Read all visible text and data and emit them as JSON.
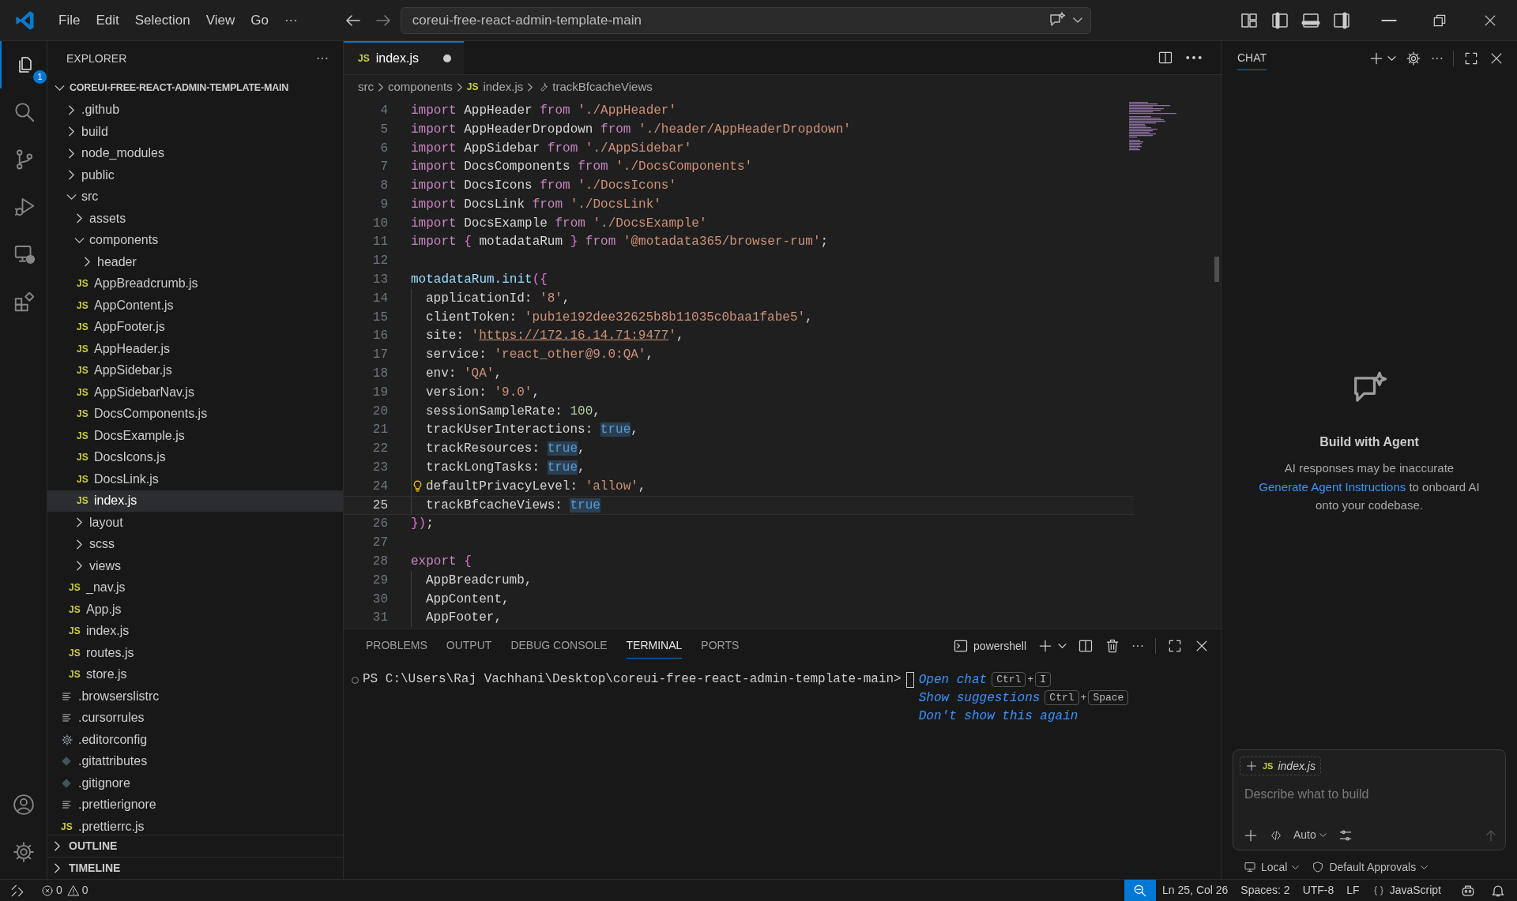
{
  "title_bar": {
    "menu": [
      "File",
      "Edit",
      "Selection",
      "View",
      "Go",
      "···"
    ],
    "command_center": "coreui-free-react-admin-template-main"
  },
  "activity_bar": {
    "top": [
      {
        "kind": "explorer",
        "selected": true,
        "badge": "1"
      },
      {
        "kind": "search",
        "selected": false
      },
      {
        "kind": "source_control",
        "selected": false
      },
      {
        "kind": "run_debug",
        "selected": false
      },
      {
        "kind": "remote",
        "selected": false
      },
      {
        "kind": "extensions",
        "selected": false
      }
    ],
    "bottom": [
      {
        "kind": "account"
      },
      {
        "kind": "settings"
      }
    ]
  },
  "explorer": {
    "title": "EXPLORER",
    "more": "···",
    "tree": {
      "label": "COREUI-FREE-REACT-ADMIN-TEMPLATE-MAIN",
      "kind": "folder",
      "expanded": true,
      "selected": false,
      "children": [
        {
          "label": ".github",
          "kind": "folder",
          "expanded": false,
          "selected": false
        },
        {
          "label": "build",
          "kind": "folder",
          "expanded": false,
          "selected": false
        },
        {
          "label": "node_modules",
          "kind": "folder",
          "expanded": false,
          "selected": false
        },
        {
          "label": "public",
          "kind": "folder",
          "expanded": false,
          "selected": false
        },
        {
          "label": "src",
          "kind": "folder",
          "expanded": true,
          "selected": false,
          "children": [
            {
              "label": "assets",
              "kind": "folder",
              "expanded": false,
              "selected": false
            },
            {
              "label": "components",
              "kind": "folder",
              "expanded": true,
              "selected": false,
              "children": [
                {
                  "label": "header",
                  "kind": "folder",
                  "expanded": false,
                  "selected": false
                },
                {
                  "label": "AppBreadcrumb.js",
                  "kind": "js",
                  "icon": "JS",
                  "selected": false
                },
                {
                  "label": "AppContent.js",
                  "kind": "js",
                  "icon": "JS",
                  "selected": false
                },
                {
                  "label": "AppFooter.js",
                  "kind": "js",
                  "icon": "JS",
                  "selected": false
                },
                {
                  "label": "AppHeader.js",
                  "kind": "js",
                  "icon": "JS",
                  "selected": false
                },
                {
                  "label": "AppSidebar.js",
                  "kind": "js",
                  "icon": "JS",
                  "selected": false
                },
                {
                  "label": "AppSidebarNav.js",
                  "kind": "js",
                  "icon": "JS",
                  "selected": false
                },
                {
                  "label": "DocsComponents.js",
                  "kind": "js",
                  "icon": "JS",
                  "selected": false
                },
                {
                  "label": "DocsExample.js",
                  "kind": "js",
                  "icon": "JS",
                  "selected": false
                },
                {
                  "label": "DocsIcons.js",
                  "kind": "js",
                  "icon": "JS",
                  "selected": false
                },
                {
                  "label": "DocsLink.js",
                  "kind": "js",
                  "icon": "JS",
                  "selected": false
                },
                {
                  "label": "index.js",
                  "kind": "js",
                  "icon": "JS",
                  "selected": true
                }
              ]
            },
            {
              "label": "layout",
              "kind": "folder",
              "expanded": false,
              "selected": false
            },
            {
              "label": "scss",
              "kind": "folder",
              "expanded": false,
              "selected": false
            },
            {
              "label": "views",
              "kind": "folder",
              "expanded": false,
              "selected": false
            },
            {
              "label": "_nav.js",
              "kind": "js",
              "icon": "JS",
              "selected": false
            },
            {
              "label": "App.js",
              "kind": "js",
              "icon": "JS",
              "selected": false
            },
            {
              "label": "index.js",
              "kind": "js",
              "icon": "JS",
              "selected": false
            },
            {
              "label": "routes.js",
              "kind": "js",
              "icon": "JS",
              "selected": false
            },
            {
              "label": "store.js",
              "kind": "js",
              "icon": "JS",
              "selected": false
            }
          ]
        },
        {
          "label": ".browserslistrc",
          "kind": "text",
          "selected": false
        },
        {
          "label": ".cursorrules",
          "kind": "text",
          "selected": false
        },
        {
          "label": ".editorconfig",
          "kind": "config",
          "selected": false
        },
        {
          "label": ".gitattributes",
          "kind": "git",
          "selected": false
        },
        {
          "label": ".gitignore",
          "kind": "git",
          "selected": false
        },
        {
          "label": ".prettierignore",
          "kind": "text",
          "selected": false
        },
        {
          "label": ".prettierrc.js",
          "kind": "js",
          "icon": "JS",
          "selected": false
        }
      ]
    },
    "sections": [
      {
        "label": "OUTLINE",
        "expanded": false
      },
      {
        "label": "TIMELINE",
        "expanded": false
      }
    ]
  },
  "editor": {
    "tabs": [
      {
        "label": "index.js",
        "kind": "js",
        "icon": "JS",
        "selected": true,
        "modified": true
      }
    ],
    "breadcrumb": [
      {
        "label": "src",
        "kind": "folder"
      },
      {
        "label": "components",
        "kind": "folder"
      },
      {
        "label": "index.js",
        "kind": "js",
        "icon": "JS"
      },
      {
        "label": "trackBfcacheViews",
        "kind": "property"
      }
    ],
    "lines": [
      {
        "n": "4",
        "t": [
          {
            "kind": "kw",
            "text": "import "
          },
          {
            "kind": "id",
            "text": "AppHeader "
          },
          {
            "kind": "kw",
            "text": "from "
          },
          {
            "kind": "str",
            "text": "'./AppHeader'"
          }
        ]
      },
      {
        "n": "5",
        "t": [
          {
            "kind": "kw",
            "text": "import "
          },
          {
            "kind": "id",
            "text": "AppHeaderDropdown "
          },
          {
            "kind": "kw",
            "text": "from "
          },
          {
            "kind": "str",
            "text": "'./header/AppHeaderDropdown'"
          }
        ]
      },
      {
        "n": "6",
        "t": [
          {
            "kind": "kw",
            "text": "import "
          },
          {
            "kind": "id",
            "text": "AppSidebar "
          },
          {
            "kind": "kw",
            "text": "from "
          },
          {
            "kind": "str",
            "text": "'./AppSidebar'"
          }
        ]
      },
      {
        "n": "7",
        "t": [
          {
            "kind": "kw",
            "text": "import "
          },
          {
            "kind": "id",
            "text": "DocsComponents "
          },
          {
            "kind": "kw",
            "text": "from "
          },
          {
            "kind": "str",
            "text": "'./DocsComponents'"
          }
        ]
      },
      {
        "n": "8",
        "t": [
          {
            "kind": "kw",
            "text": "import "
          },
          {
            "kind": "id",
            "text": "DocsIcons "
          },
          {
            "kind": "kw",
            "text": "from "
          },
          {
            "kind": "str",
            "text": "'./DocsIcons'"
          }
        ]
      },
      {
        "n": "9",
        "t": [
          {
            "kind": "kw",
            "text": "import "
          },
          {
            "kind": "id",
            "text": "DocsLink "
          },
          {
            "kind": "kw",
            "text": "from "
          },
          {
            "kind": "str",
            "text": "'./DocsLink'"
          }
        ]
      },
      {
        "n": "10",
        "t": [
          {
            "kind": "kw",
            "text": "import "
          },
          {
            "kind": "id",
            "text": "DocsExample "
          },
          {
            "kind": "kw",
            "text": "from "
          },
          {
            "kind": "str",
            "text": "'./DocsExample'"
          }
        ]
      },
      {
        "n": "11",
        "t": [
          {
            "kind": "kw",
            "text": "import "
          },
          {
            "kind": "brace",
            "text": "{ "
          },
          {
            "kind": "id",
            "text": "motadataRum "
          },
          {
            "kind": "brace",
            "text": "} "
          },
          {
            "kind": "kw",
            "text": "from "
          },
          {
            "kind": "str",
            "text": "'@motadata365/browser-rum'"
          },
          {
            "kind": "p",
            "text": ";"
          }
        ]
      },
      {
        "n": "12"
      },
      {
        "n": "13",
        "t": [
          {
            "kind": "fn",
            "text": "motadataRum.init"
          },
          {
            "kind": "brace",
            "text": "({"
          }
        ]
      },
      {
        "n": "14",
        "indented": true,
        "t": [
          {
            "kind": "id",
            "text": "applicationId: "
          },
          {
            "kind": "str",
            "text": "'8'"
          },
          {
            "kind": "p",
            "text": ","
          }
        ]
      },
      {
        "n": "15",
        "indented": true,
        "t": [
          {
            "kind": "id",
            "text": "clientToken: "
          },
          {
            "kind": "str",
            "text": "'pub1e192dee32625b8b11035c0baa1fabe5'"
          },
          {
            "kind": "p",
            "text": ","
          }
        ]
      },
      {
        "n": "16",
        "indented": true,
        "t": [
          {
            "kind": "id",
            "text": "site: "
          },
          {
            "kind": "str",
            "text": "'"
          },
          {
            "kind": "link",
            "text": "https://172.16.14.71:9477"
          },
          {
            "kind": "str",
            "text": "'"
          },
          {
            "kind": "p",
            "text": ","
          }
        ]
      },
      {
        "n": "17",
        "indented": true,
        "t": [
          {
            "kind": "id",
            "text": "service: "
          },
          {
            "kind": "str",
            "text": "'react_other@9.0:QA'"
          },
          {
            "kind": "p",
            "text": ","
          }
        ]
      },
      {
        "n": "18",
        "indented": true,
        "t": [
          {
            "kind": "id",
            "text": "env: "
          },
          {
            "kind": "str",
            "text": "'QA'"
          },
          {
            "kind": "p",
            "text": ","
          }
        ]
      },
      {
        "n": "19",
        "indented": true,
        "t": [
          {
            "kind": "id",
            "text": "version: "
          },
          {
            "kind": "str",
            "text": "'9.0'"
          },
          {
            "kind": "p",
            "text": ","
          }
        ]
      },
      {
        "n": "20",
        "indented": true,
        "t": [
          {
            "kind": "id",
            "text": "sessionSampleRate: "
          },
          {
            "kind": "num",
            "text": "100"
          },
          {
            "kind": "p",
            "text": ","
          }
        ]
      },
      {
        "n": "21",
        "indented": true,
        "t": [
          {
            "kind": "id",
            "text": "trackUserInteractions: "
          },
          {
            "kind": "bool",
            "text": "true"
          },
          {
            "kind": "p",
            "text": ","
          }
        ]
      },
      {
        "n": "22",
        "indented": true,
        "t": [
          {
            "kind": "id",
            "text": "trackResources: "
          },
          {
            "kind": "bool",
            "text": "true"
          },
          {
            "kind": "p",
            "text": ","
          }
        ]
      },
      {
        "n": "23",
        "indented": true,
        "t": [
          {
            "kind": "id",
            "text": "trackLongTasks: "
          },
          {
            "kind": "bool",
            "text": "true"
          },
          {
            "kind": "p",
            "text": ","
          }
        ]
      },
      {
        "n": "24",
        "indented": true,
        "lightbulb": true,
        "t": [
          {
            "kind": "id",
            "text": "defaultPrivacyLevel: "
          },
          {
            "kind": "str",
            "text": "'allow'"
          },
          {
            "kind": "p",
            "text": ","
          }
        ]
      },
      {
        "n": "25",
        "indented": true,
        "current": true,
        "t": [
          {
            "kind": "id",
            "text": "trackBfcacheViews: "
          },
          {
            "kind": "bool",
            "text": "true"
          }
        ]
      },
      {
        "n": "26",
        "t": [
          {
            "kind": "brace",
            "text": "})"
          },
          {
            "kind": "p",
            "text": ";"
          }
        ]
      },
      {
        "n": "27"
      },
      {
        "n": "28",
        "t": [
          {
            "kind": "kw",
            "text": "export "
          },
          {
            "kind": "brace",
            "text": "{"
          }
        ]
      },
      {
        "n": "29",
        "indented": true,
        "t": [
          {
            "kind": "id",
            "text": "AppBreadcrumb"
          },
          {
            "kind": "p",
            "text": ","
          }
        ]
      },
      {
        "n": "30",
        "indented": true,
        "t": [
          {
            "kind": "id",
            "text": "AppContent"
          },
          {
            "kind": "p",
            "text": ","
          }
        ]
      },
      {
        "n": "31",
        "indented": true,
        "t": [
          {
            "kind": "id",
            "text": "AppFooter"
          },
          {
            "kind": "p",
            "text": ","
          }
        ]
      }
    ]
  },
  "panel": {
    "tabs": [
      {
        "label": "PROBLEMS",
        "selected": false
      },
      {
        "label": "OUTPUT",
        "selected": false
      },
      {
        "label": "DEBUG CONSOLE",
        "selected": false
      },
      {
        "label": "TERMINAL",
        "selected": true
      },
      {
        "label": "PORTS",
        "selected": false
      }
    ],
    "terminal_name": "powershell",
    "more": "···",
    "prompt": "PS C:\\Users\\Raj Vachhani\\Desktop\\coreui-free-react-admin-template-main>",
    "hints": [
      {
        "text": "Open chat",
        "keys": [
          {
            "kind": "key",
            "text": "Ctrl"
          },
          {
            "kind": "sep",
            "text": "+"
          },
          {
            "kind": "key",
            "text": "I"
          }
        ]
      },
      {
        "text": "Show suggestions",
        "keys": [
          {
            "kind": "key",
            "text": "Ctrl"
          },
          {
            "kind": "sep",
            "text": "+"
          },
          {
            "kind": "key",
            "text": "Space"
          }
        ]
      },
      {
        "text": "Don't show this again"
      }
    ]
  },
  "chat": {
    "tab": "CHAT",
    "more": "···",
    "title": "Build with Agent",
    "note": "AI responses may be inaccurate",
    "link": "Generate Agent Instructions",
    "link_rest": " to onboard AI onto your codebase.",
    "context_file": {
      "label": "index.js",
      "icon": "JS"
    },
    "placeholder": "Describe what to build",
    "mode": "Auto",
    "location": "Local",
    "approvals": "Default Approvals"
  },
  "status_bar": {
    "errors": "0",
    "warnings": "0",
    "items": [
      "Ln 25, Col 26",
      "Spaces: 2",
      "UTF-8",
      "LF",
      "JavaScript"
    ]
  }
}
